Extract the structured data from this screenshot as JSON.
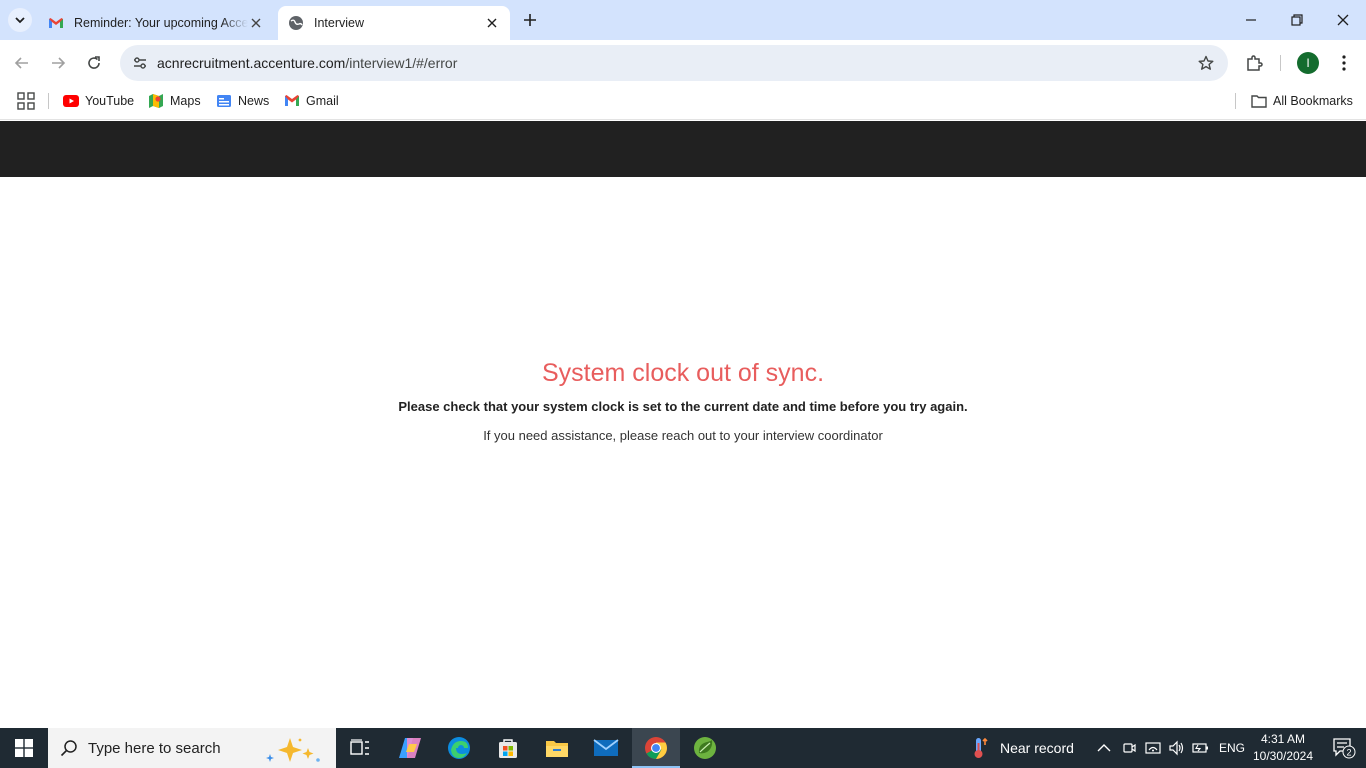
{
  "browser": {
    "tabs": [
      {
        "title": "Reminder: Your upcoming Accenture",
        "favicon": "gmail-icon",
        "active": false
      },
      {
        "title": "Interview",
        "favicon": "globe-icon",
        "active": true
      }
    ],
    "url": {
      "host": "acnrecruitment.accenture.com",
      "path": "/interview1/#/error"
    },
    "profile_initial": "I",
    "bookmarks": [
      {
        "label": "YouTube",
        "icon": "youtube-icon"
      },
      {
        "label": "Maps",
        "icon": "maps-icon"
      },
      {
        "label": "News",
        "icon": "news-icon"
      },
      {
        "label": "Gmail",
        "icon": "gmail-icon"
      }
    ],
    "all_bookmarks_label": "All Bookmarks"
  },
  "page": {
    "header_color": "#212121",
    "error_title": "System clock out of sync.",
    "error_message": "Please check that your system clock is set to the current date and time before you try again.",
    "help_text": "If you need assistance, please reach out to your interview coordinator",
    "error_color": "#e85d5d"
  },
  "taskbar": {
    "search_placeholder": "Type here to search",
    "apps": [
      "task-view-icon",
      "copilot-icon",
      "edge-icon",
      "store-icon",
      "file-explorer-icon",
      "mail-icon",
      "chrome-icon",
      "spring-icon"
    ],
    "active_app": "chrome-icon",
    "weather_text": "Near record",
    "language": "ENG",
    "time": "4:31 AM",
    "date": "10/30/2024",
    "notification_count": "2"
  }
}
